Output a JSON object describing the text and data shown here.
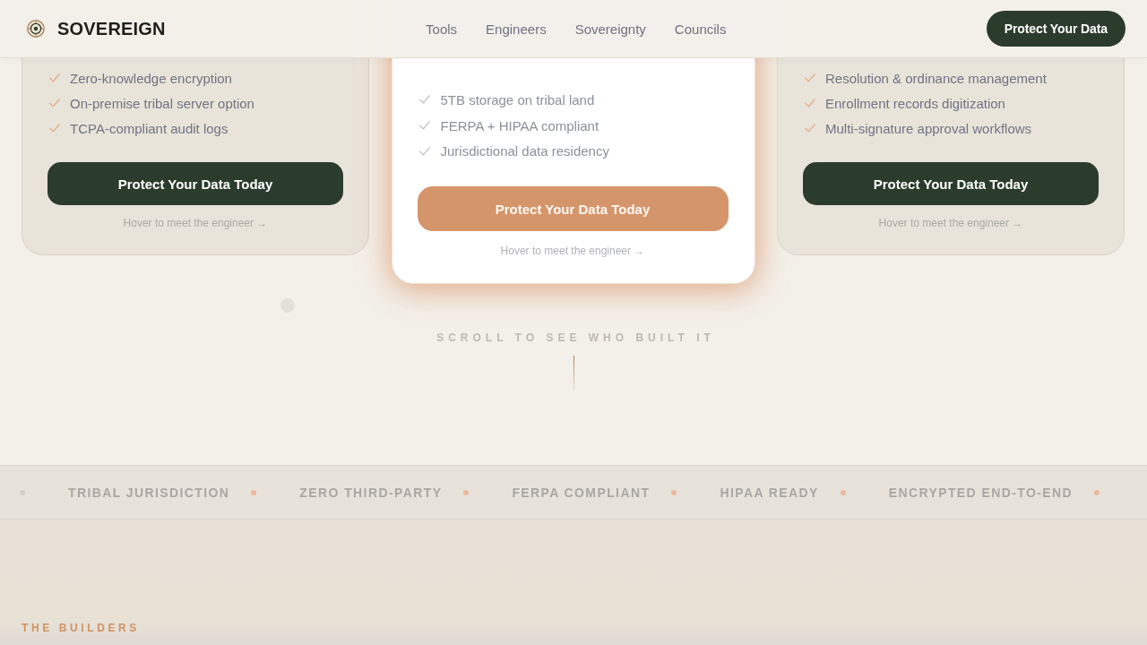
{
  "header": {
    "brand": "SOVEREIGN",
    "nav": [
      "Tools",
      "Engineers",
      "Sovereignty",
      "Councils"
    ],
    "cta": "Protect Your Data"
  },
  "plans": [
    {
      "featured": false,
      "features": [
        "Zero-knowledge encryption",
        "On-premise tribal server option",
        "TCPA-compliant audit logs"
      ],
      "button": "Protect Your Data Today",
      "hint": "Hover to meet the engineer →"
    },
    {
      "featured": true,
      "features": [
        "5TB storage on tribal land",
        "FERPA + HIPAA compliant",
        "Jurisdictional data residency"
      ],
      "button": "Protect Your Data Today",
      "hint": "Hover to meet the engineer →"
    },
    {
      "featured": false,
      "features": [
        "Resolution & ordinance management",
        "Enrollment records digitization",
        "Multi-signature approval workflows"
      ],
      "button": "Protect Your Data Today",
      "hint": "Hover to meet the engineer →"
    }
  ],
  "scroll_hint": "SCROLL TO SEE WHO BUILT IT",
  "ticker": {
    "lead": {
      "color": "#d3cec7"
    },
    "items": [
      {
        "label": "TRIBAL JURISDICTION",
        "color": "#ebb99e"
      },
      {
        "label": "ZERO THIRD-PARTY",
        "color": "#ebb99e"
      },
      {
        "label": "FERPA COMPLIANT",
        "color": "#ebb99e"
      },
      {
        "label": "HIPAA READY",
        "color": "#ebb99e"
      },
      {
        "label": "ENCRYPTED END-TO-END",
        "color": "#ebb99e"
      }
    ]
  },
  "builders": {
    "eyebrow": "THE BUILDERS"
  }
}
